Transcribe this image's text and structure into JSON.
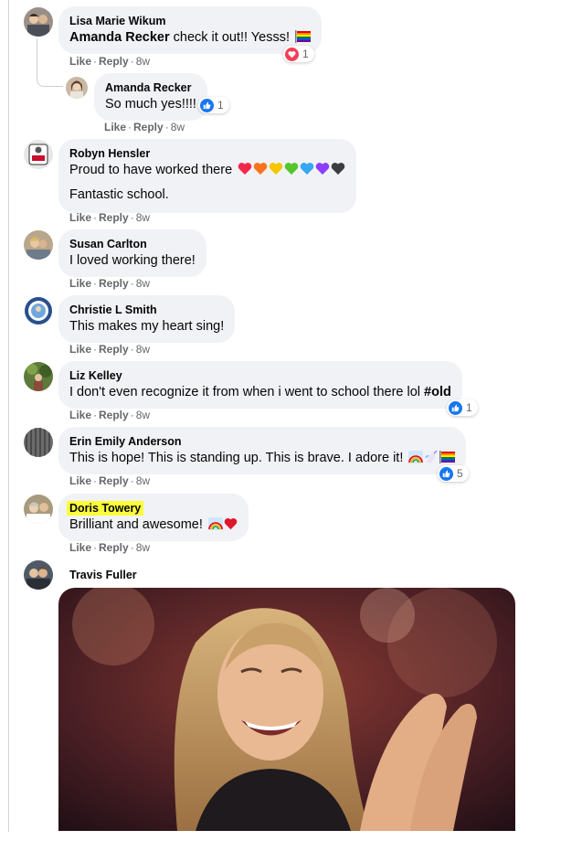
{
  "actions": {
    "like": "Like",
    "reply": "Reply",
    "dot": "·"
  },
  "comments": [
    {
      "author": "Lisa Marie Wikum",
      "mention": "Amanda Recker",
      "text": " check it out!! Yesss!",
      "time": "8w",
      "reaction": {
        "type": "love",
        "count": "1"
      }
    },
    {
      "author": "Amanda Recker",
      "text": "So much yes!!!!",
      "time": "8w",
      "reaction": {
        "type": "like",
        "count": "1"
      }
    },
    {
      "author": "Robyn Hensler",
      "text": "Proud to have worked there",
      "text2": "Fantastic school.",
      "time": "8w",
      "hearts": [
        "#f02849",
        "#f7731c",
        "#f7c500",
        "#54c62c",
        "#35a7f3",
        "#8a3ffc",
        "#3b3d41"
      ]
    },
    {
      "author": "Susan Carlton",
      "text": "I loved working there!",
      "time": "8w"
    },
    {
      "author": "Christie L Smith",
      "text": "This makes my heart sing!",
      "time": "8w"
    },
    {
      "author": "Liz Kelley",
      "text": "I don't even recognize it from when i went to school there lol ",
      "tag": "#old",
      "time": "8w",
      "reaction": {
        "type": "like",
        "count": "1"
      }
    },
    {
      "author": "Erin Emily Anderson",
      "text": "This is hope! This is standing up. This is brave. I adore it!",
      "time": "8w",
      "reaction": {
        "type": "like",
        "count": "5"
      }
    },
    {
      "author": "Doris Towery",
      "text": "Brilliant and awesome!",
      "time": "8w"
    },
    {
      "author": "Travis Fuller"
    }
  ],
  "colors": {
    "link_blue": "#1877f2",
    "love_red": "#f33e58",
    "highlight": "#fbff3a",
    "bubble_bg": "#f0f2f5",
    "meta_gray": "#65676b"
  }
}
